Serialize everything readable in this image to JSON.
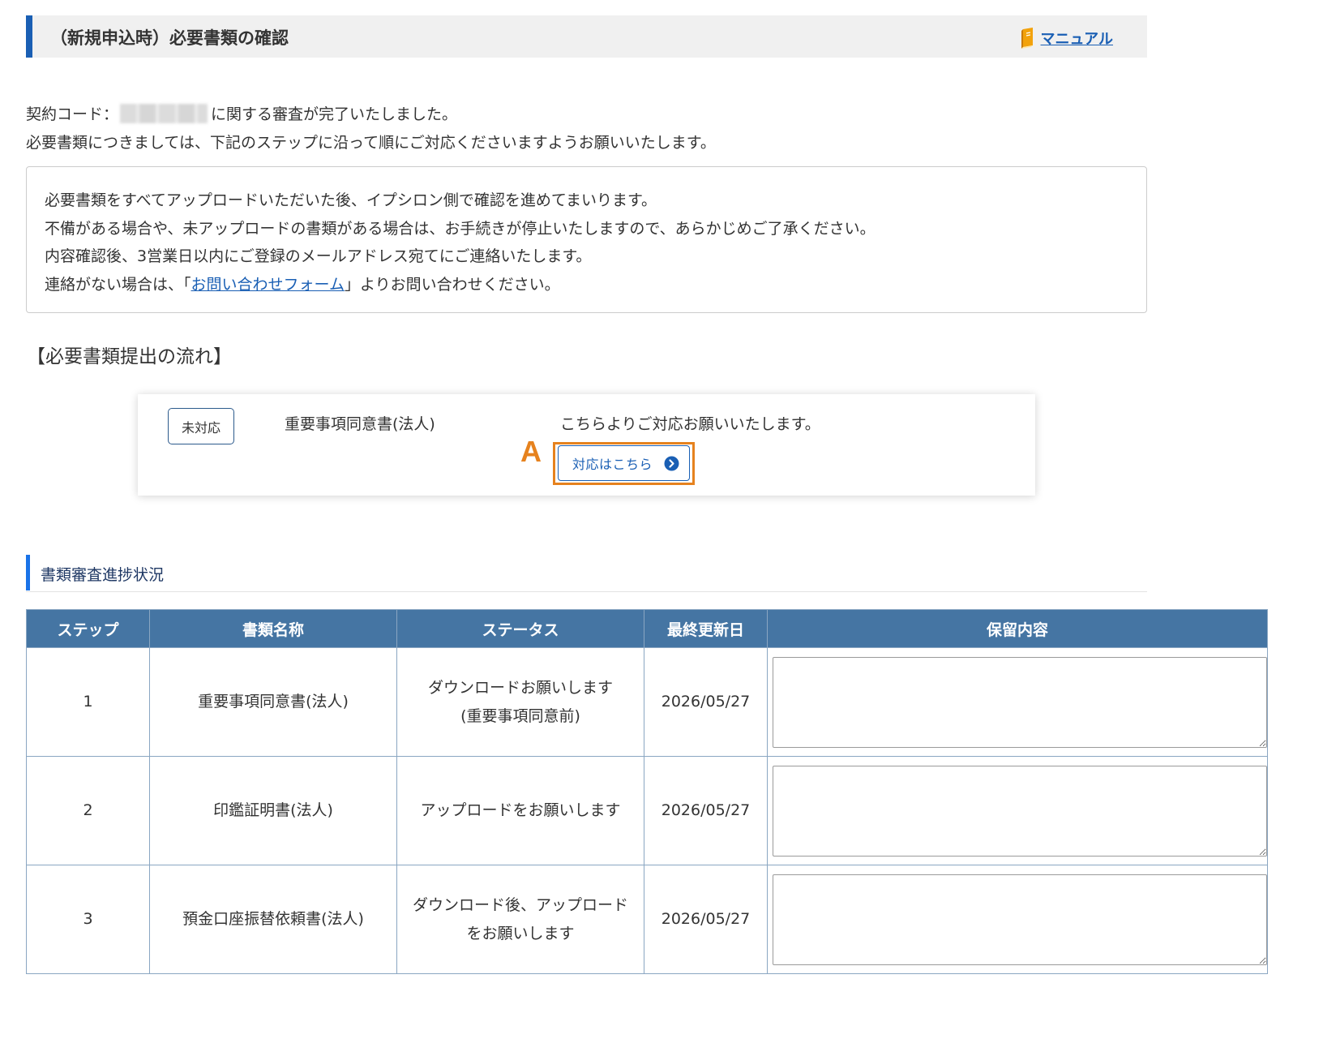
{
  "header": {
    "title": "（新規申込時）必要書類の確認",
    "manual_link": "マニュアル",
    "manual_icon": "book-icon"
  },
  "intro": {
    "line1_prefix": "契約コード：",
    "line1_suffix": "に関する審査が完了いたしました。",
    "line2": "必要書類につきましては、下記のステップに沿って順にご対応くださいますようお願いいたします。"
  },
  "notice": {
    "line1": "必要書類をすべてアップロードいただいた後、イプシロン側で確認を進めてまいります。",
    "line2": "不備がある場合や、未アップロードの書類がある場合は、お手続きが停止いたしますので、あらかじめご了承ください。",
    "line3": "内容確認後、3営業日以内にご登録のメールアドレス宛てにご連絡いたします。",
    "line4_prefix": "連絡がない場合は、「",
    "line4_link": "お問い合わせフォーム",
    "line4_suffix": "」よりお問い合わせください。"
  },
  "flow": {
    "heading": "【必要書類提出の流れ】",
    "status": "未対応",
    "document": "重要事項同意書(法人)",
    "message": "こちらよりご対応お願いいたします。",
    "button_label": "対応はこちら",
    "button_icon": "arrow-circle-right-icon",
    "annotation": "A"
  },
  "progress": {
    "heading": "書類審査進捗状況",
    "columns": [
      "ステップ",
      "書類名称",
      "ステータス",
      "最終更新日",
      "保留内容"
    ],
    "rows": [
      {
        "step": "1",
        "name": "重要事項同意書(法人)",
        "status": "ダウンロードお願いします\n(重要事項同意前)",
        "date": "2026/05/27",
        "note": ""
      },
      {
        "step": "2",
        "name": "印鑑証明書(法人)",
        "status": "アップロードをお願いします",
        "date": "2026/05/27",
        "note": ""
      },
      {
        "step": "3",
        "name": "預金口座振替依頼書(法人)",
        "status": "ダウンロード後、アップロード\nをお願いします",
        "date": "2026/05/27",
        "note": ""
      }
    ]
  },
  "colors": {
    "accent": "#1a5fb4",
    "table_header": "#4575a3",
    "annotation": "#e6821e"
  }
}
